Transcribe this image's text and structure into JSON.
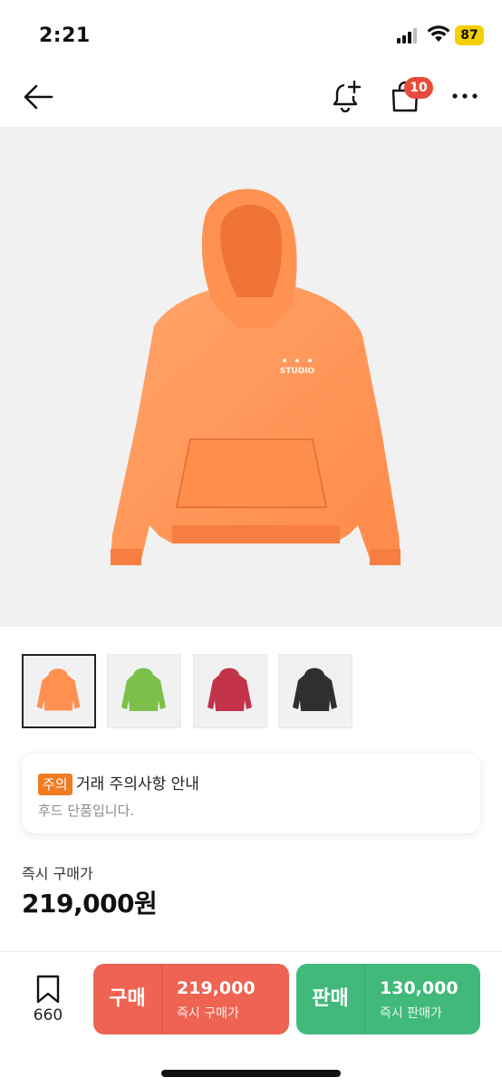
{
  "status": {
    "time": "2:21",
    "battery": "87"
  },
  "nav": {
    "cart_badge": "10"
  },
  "notice": {
    "tag": "주의",
    "title": "거래 주의사항 안내",
    "description": "후드 단품입니다."
  },
  "price": {
    "label": "즉시 구매가",
    "value": "219,000원"
  },
  "bottom": {
    "wish_count": "660",
    "buy": {
      "label": "구매",
      "price": "219,000",
      "sub": "즉시 구매가"
    },
    "sell": {
      "label": "판매",
      "price": "130,000",
      "sub": "즉시 판매가"
    }
  },
  "thumbnails": [
    {
      "color": "orange",
      "selected": true
    },
    {
      "color": "green",
      "selected": false
    },
    {
      "color": "red",
      "selected": false
    },
    {
      "color": "charcoal",
      "selected": false
    }
  ],
  "colors": {
    "buy": "#ee6352",
    "sell": "#41b97a",
    "notice_tag": "#f07c22",
    "badge": "#e84a3d",
    "hoodie_orange": "#ff9a5c"
  },
  "icons": [
    "back-arrow-icon",
    "bell-plus-icon",
    "shopping-bag-icon",
    "more-icon",
    "bookmark-icon"
  ]
}
